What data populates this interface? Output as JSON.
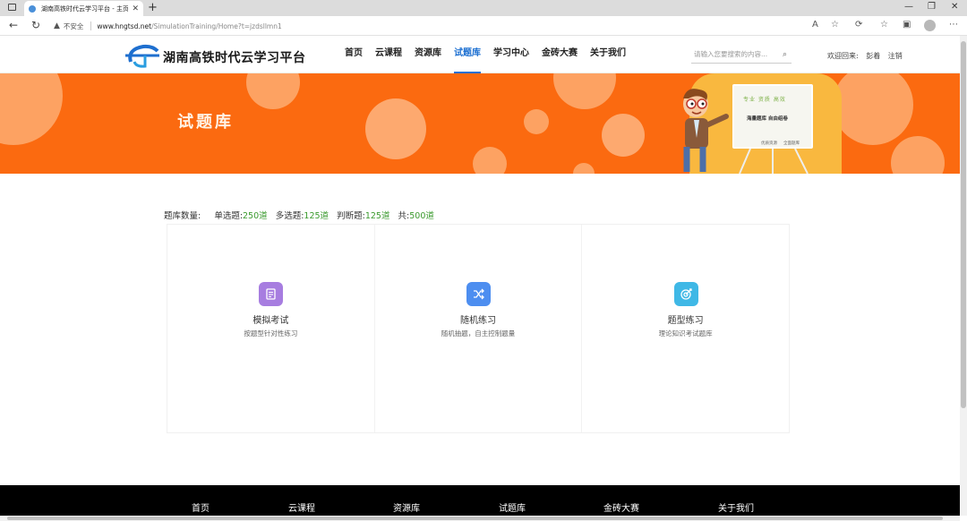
{
  "browser": {
    "tab_title": "湖南高铁时代云学习平台 - 主页",
    "tab_close": "✕",
    "new_tab": "+",
    "insecure_label": "不安全",
    "url_host": "www.hngtsd.net",
    "url_path": "/SimulationTraining/Home?t=jzdsllmn1"
  },
  "header": {
    "logo_text": "湖南高铁时代云学习平台",
    "nav": [
      "首页",
      "云课程",
      "资源库",
      "试题库",
      "学习中心",
      "金砖大赛",
      "关于我们"
    ],
    "active_nav_index": 3,
    "search_placeholder": "请输入您要搜索的内容...",
    "welcome": "欢迎回来:",
    "user": "彭着",
    "logout": "注销"
  },
  "banner": {
    "title": "试题库",
    "board_line1": "专业 资质 高效",
    "board_line2": "海量题库 自由组卷",
    "board_line3a": "优质资源",
    "board_line3b": "全面题库"
  },
  "stats": {
    "label": "题库数量:",
    "single_label": "单选题:",
    "single_value": "250道",
    "multi_label": "多选题:",
    "multi_value": "125道",
    "judge_label": "判断题:",
    "judge_value": "125道",
    "total_label": "共:",
    "total_value": "500道"
  },
  "cards": [
    {
      "title": "模拟考试",
      "subtitle": "按题型针对性练习",
      "icon": "document-icon",
      "color": "#a77de0"
    },
    {
      "title": "随机练习",
      "subtitle": "随机抽题，自主控制题量",
      "icon": "shuffle-icon",
      "color": "#4d8ef0"
    },
    {
      "title": "题型练习",
      "subtitle": "理论知识考试题库",
      "icon": "target-icon",
      "color": "#3fb8e6"
    }
  ],
  "footer": {
    "items": [
      "首页",
      "云课程",
      "资源库",
      "试题库",
      "金砖大赛",
      "关于我们"
    ]
  },
  "colors": {
    "banner": "#fb6a10",
    "accent": "#1c6fd1",
    "count_green": "#3a9a2d"
  }
}
